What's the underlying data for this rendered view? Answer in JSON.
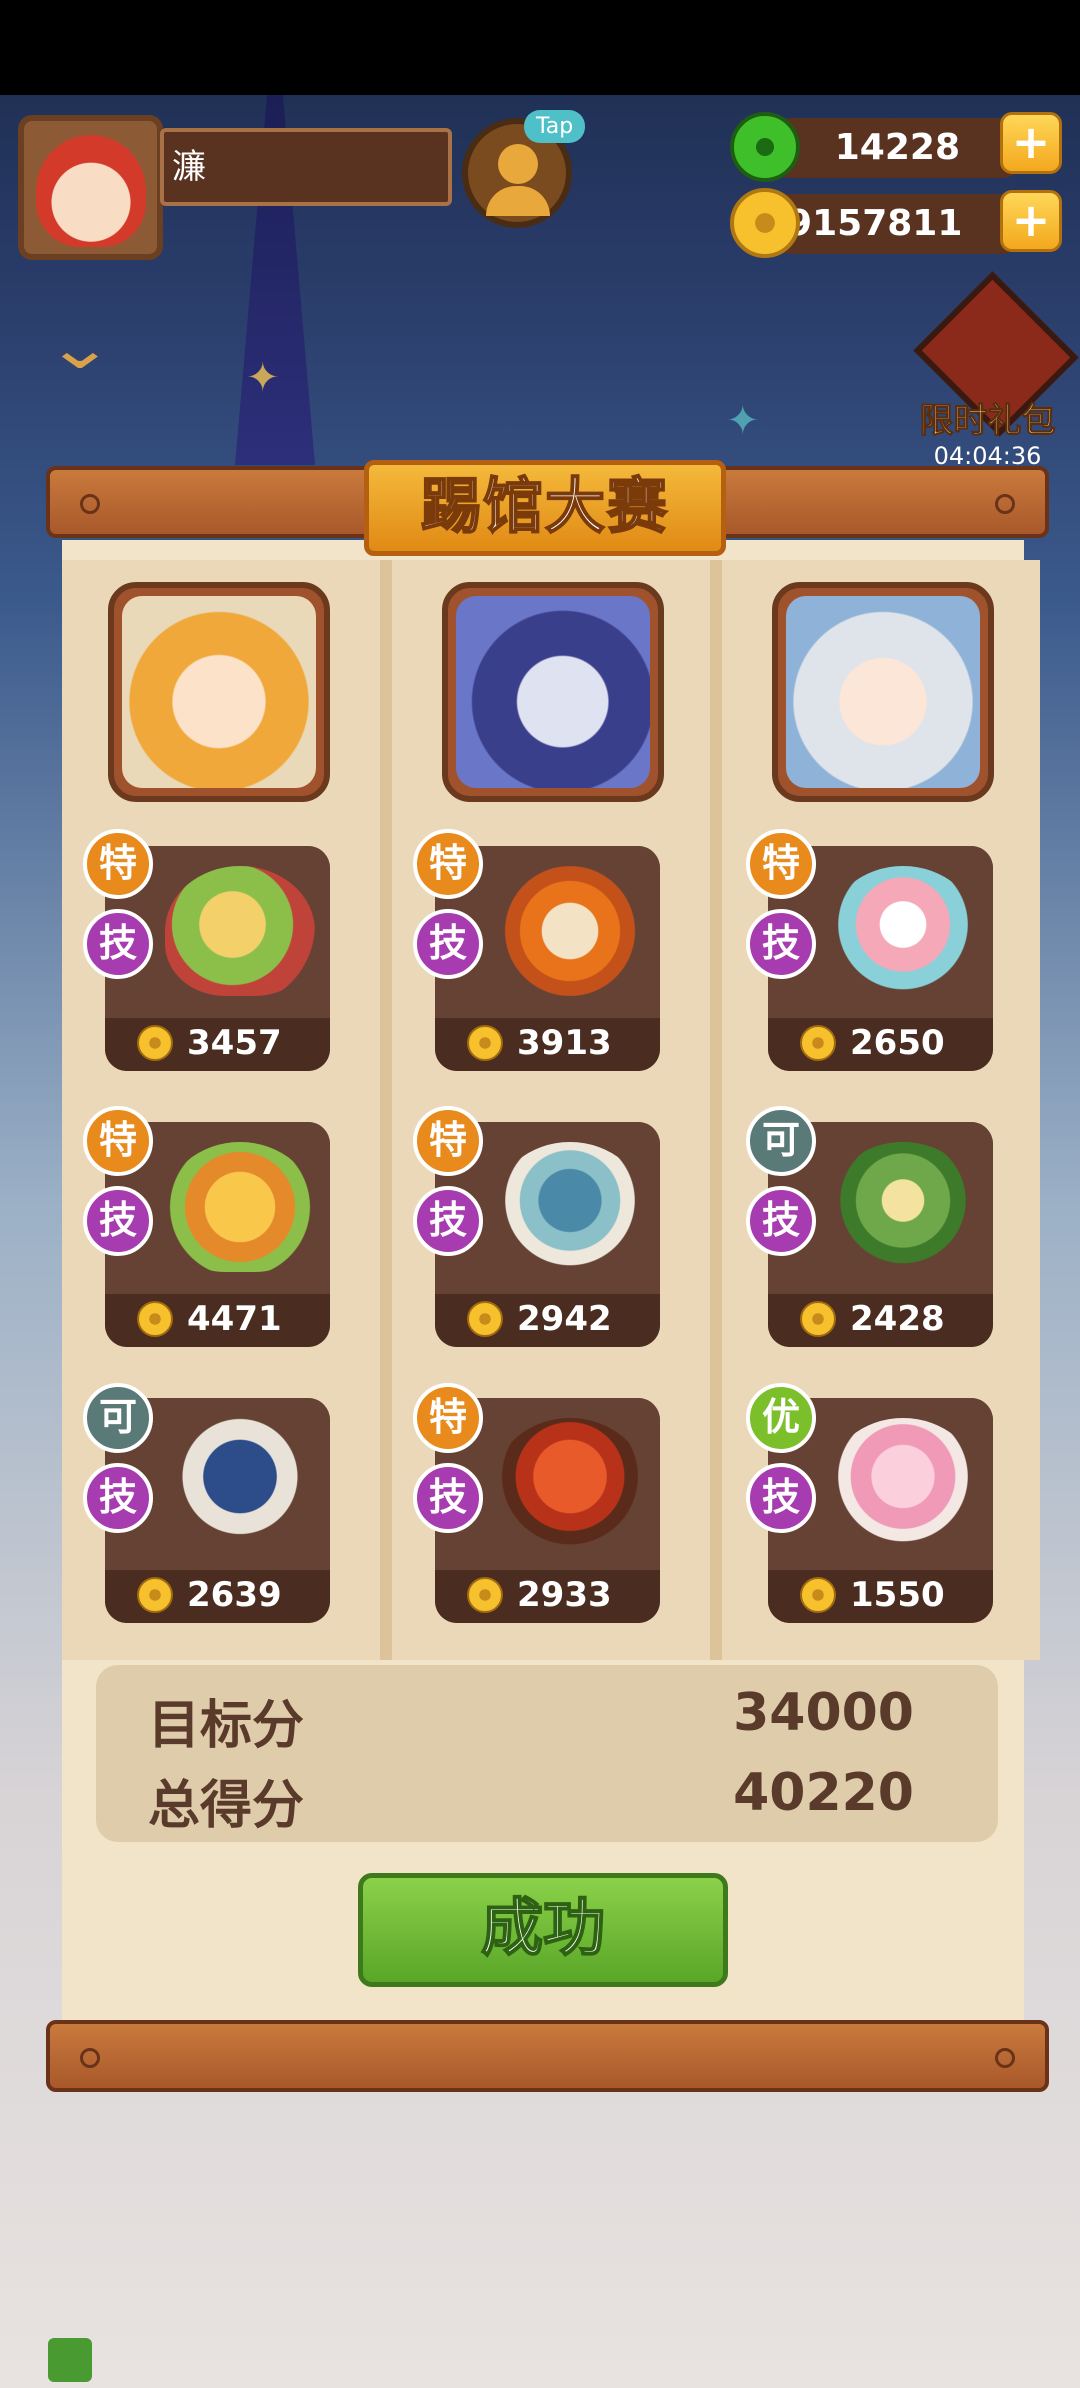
{
  "player": {
    "name": "濂"
  },
  "hud": {
    "tap_label": "Tap",
    "jade": "14228",
    "gold": "69157811",
    "plus": "+"
  },
  "gift": {
    "label": "限时礼包",
    "timer": "04:04:36"
  },
  "panel": {
    "title": "踢馆大赛"
  },
  "columns": [
    {
      "dishes": [
        {
          "badge": "特",
          "badge_kind": "te",
          "skill": "技",
          "score": "3457"
        },
        {
          "badge": "特",
          "badge_kind": "te",
          "skill": "技",
          "score": "4471"
        },
        {
          "badge": "可",
          "badge_kind": "ke",
          "skill": "技",
          "score": "2639"
        }
      ]
    },
    {
      "dishes": [
        {
          "badge": "特",
          "badge_kind": "te",
          "skill": "技",
          "score": "3913"
        },
        {
          "badge": "特",
          "badge_kind": "te",
          "skill": "技",
          "score": "2942"
        },
        {
          "badge": "特",
          "badge_kind": "te",
          "skill": "技",
          "score": "2933"
        }
      ]
    },
    {
      "dishes": [
        {
          "badge": "特",
          "badge_kind": "te",
          "skill": "技",
          "score": "2650"
        },
        {
          "badge": "可",
          "badge_kind": "ke",
          "skill": "技",
          "score": "2428"
        },
        {
          "badge": "优",
          "badge_kind": "you",
          "skill": "技",
          "score": "1550"
        }
      ]
    }
  ],
  "result": {
    "target_label": "目标分",
    "target_value": "34000",
    "total_label": "总得分",
    "total_value": "40220",
    "button": "成功"
  }
}
